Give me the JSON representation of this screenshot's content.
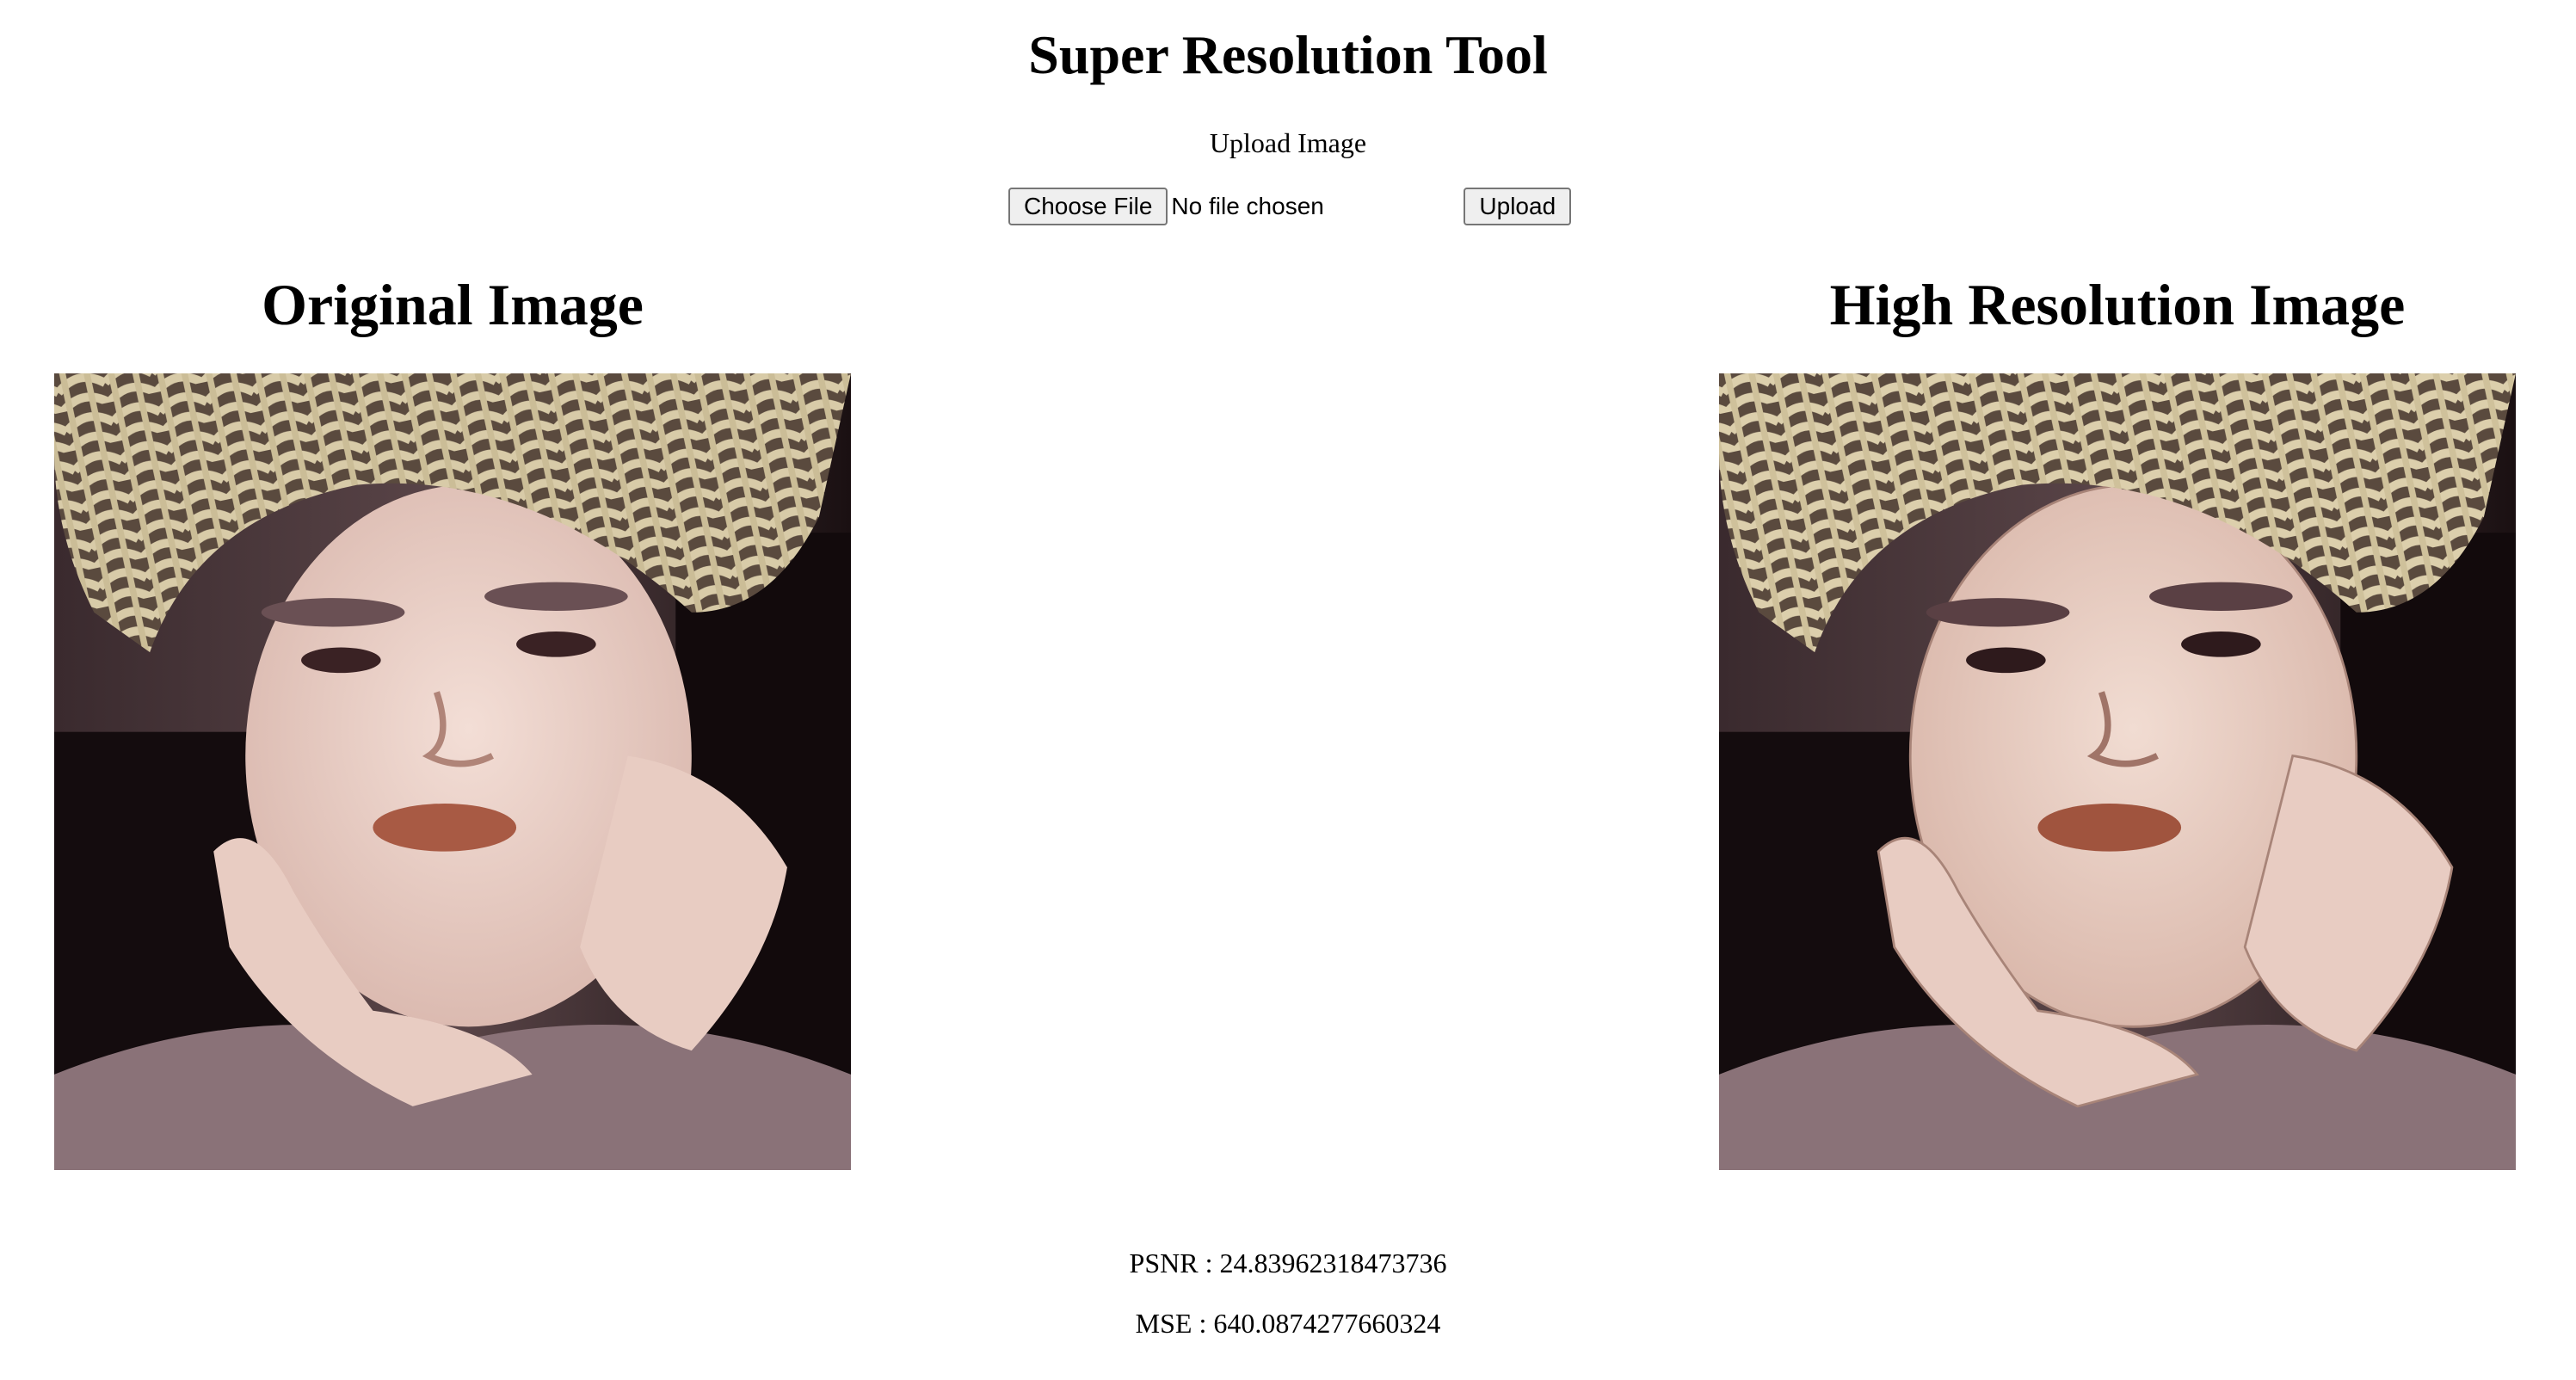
{
  "page": {
    "title": "Super Resolution Tool",
    "upload_label": "Upload Image"
  },
  "form": {
    "choose_file_label": "Choose File",
    "file_status": "No file chosen",
    "upload_label": "Upload"
  },
  "panels": {
    "original_title": "Original Image",
    "high_res_title": "High Resolution Image"
  },
  "metrics": {
    "psnr": "PSNR : 24.83962318473736",
    "mse": "MSE : 640.0874277660324"
  }
}
